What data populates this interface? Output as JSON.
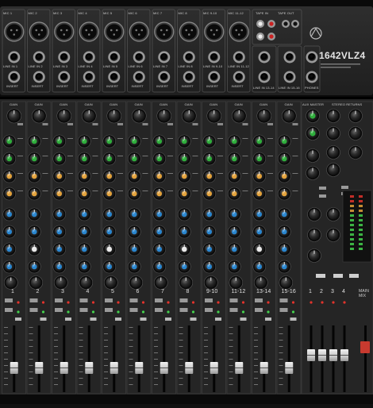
{
  "product": {
    "model": "1642VLZ4",
    "brand_color": "#e4e4e4"
  },
  "top_row_labels": [
    "MIC 1",
    "MIC 2",
    "MIC 3",
    "MIC 4",
    "MIC 5",
    "MIC 6",
    "MIC 7",
    "MIC 8",
    "MIC 9-10",
    "MIC 11-12",
    "TAPE IN",
    "TAPE OUT"
  ],
  "line_labels": [
    "LINE IN 1",
    "LINE IN 2",
    "LINE IN 3",
    "LINE IN 4",
    "LINE IN 5",
    "LINE IN 6",
    "LINE IN 7",
    "LINE IN 8",
    "LINE IN 9-10",
    "LINE IN 11-12",
    "LINE IN 13-14",
    "LINE IN 15-16",
    "PHONES"
  ],
  "insert_label": "INSERT",
  "section_labels": {
    "gain": "GAIN",
    "aux_master": "AUX MASTER",
    "stereo_returns": "STEREO RETURNS"
  },
  "channel_numbers": [
    "1",
    "2",
    "3",
    "4",
    "5",
    "6",
    "7",
    "8",
    "9-10",
    "11-12",
    "13-14",
    "15-16"
  ],
  "bus_numbers": [
    "1",
    "2",
    "3",
    "4"
  ],
  "main_mix_label": "MAIN MIX",
  "colors": {
    "panel": "#2a2a2a",
    "strip_border": "#4a4a4a",
    "knob_dark": "#1a1a1a",
    "knob_green": "#2fae3c",
    "knob_orange": "#e3a23b",
    "knob_blue": "#2a86cf",
    "knob_white": "#e9e9e9",
    "led_red": "#e2332c",
    "led_green": "#44d14e"
  }
}
